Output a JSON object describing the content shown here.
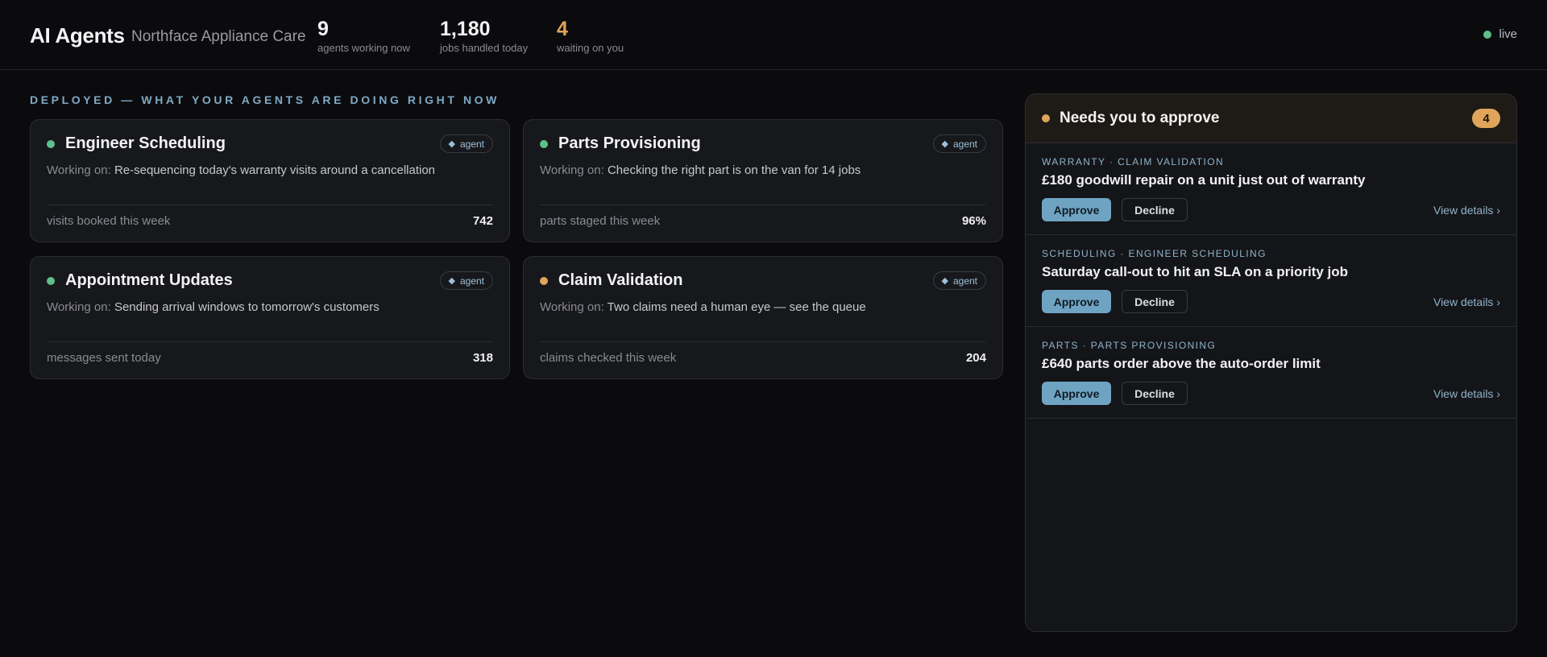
{
  "header": {
    "title": "AI Agents",
    "company": "Northface Appliance Care",
    "stats": [
      {
        "value": "9",
        "label": "agents working now"
      },
      {
        "value": "1,180",
        "label": "jobs handled today"
      },
      {
        "value": "4",
        "label": "waiting on you"
      }
    ],
    "live_label": "live"
  },
  "section_title": "DEPLOYED — WHAT YOUR AGENTS ARE DOING RIGHT NOW",
  "agents": [
    {
      "name": "Engineer Scheduling",
      "badge": "agent",
      "status": "green",
      "working_prefix": "Working on:",
      "working": "Re-sequencing today's warranty visits around a cancellation",
      "metric_label": "visits booked this week",
      "metric_value": "742"
    },
    {
      "name": "Parts Provisioning",
      "badge": "agent",
      "status": "green",
      "working_prefix": "Working on:",
      "working": "Checking the right part is on the van for 14 jobs",
      "metric_label": "parts staged this week",
      "metric_value": "96%"
    },
    {
      "name": "Appointment Updates",
      "badge": "agent",
      "status": "green",
      "working_prefix": "Working on:",
      "working": "Sending arrival windows to tomorrow's customers",
      "metric_label": "messages sent today",
      "metric_value": "318"
    },
    {
      "name": "Claim Validation",
      "badge": "agent",
      "status": "amber",
      "working_prefix": "Working on:",
      "working": "Two claims need a human eye — see the queue",
      "metric_label": "claims checked this week",
      "metric_value": "204"
    }
  ],
  "approvals_panel": {
    "title": "Needs you to approve",
    "count": "4",
    "items": [
      {
        "tag": "WARRANTY · CLAIM VALIDATION",
        "summary": "£180 goodwill repair on a unit just out of warranty",
        "approve": "Approve",
        "decline": "Decline",
        "details": "View details ›"
      },
      {
        "tag": "SCHEDULING · ENGINEER SCHEDULING",
        "summary": "Saturday call-out to hit an SLA on a priority job",
        "approve": "Approve",
        "decline": "Decline",
        "details": "View details ›"
      },
      {
        "tag": "PARTS · PARTS PROVISIONING",
        "summary": "£640 parts order above the auto-order limit",
        "approve": "Approve",
        "decline": "Decline",
        "details": "View details ›"
      }
    ]
  },
  "colors": {
    "green": "#5fbf8a",
    "amber": "#e0a45a",
    "accent": "#6fa3c2"
  },
  "icons": {
    "status": "status-dot-icon",
    "agent_badge": "diamond-icon"
  }
}
